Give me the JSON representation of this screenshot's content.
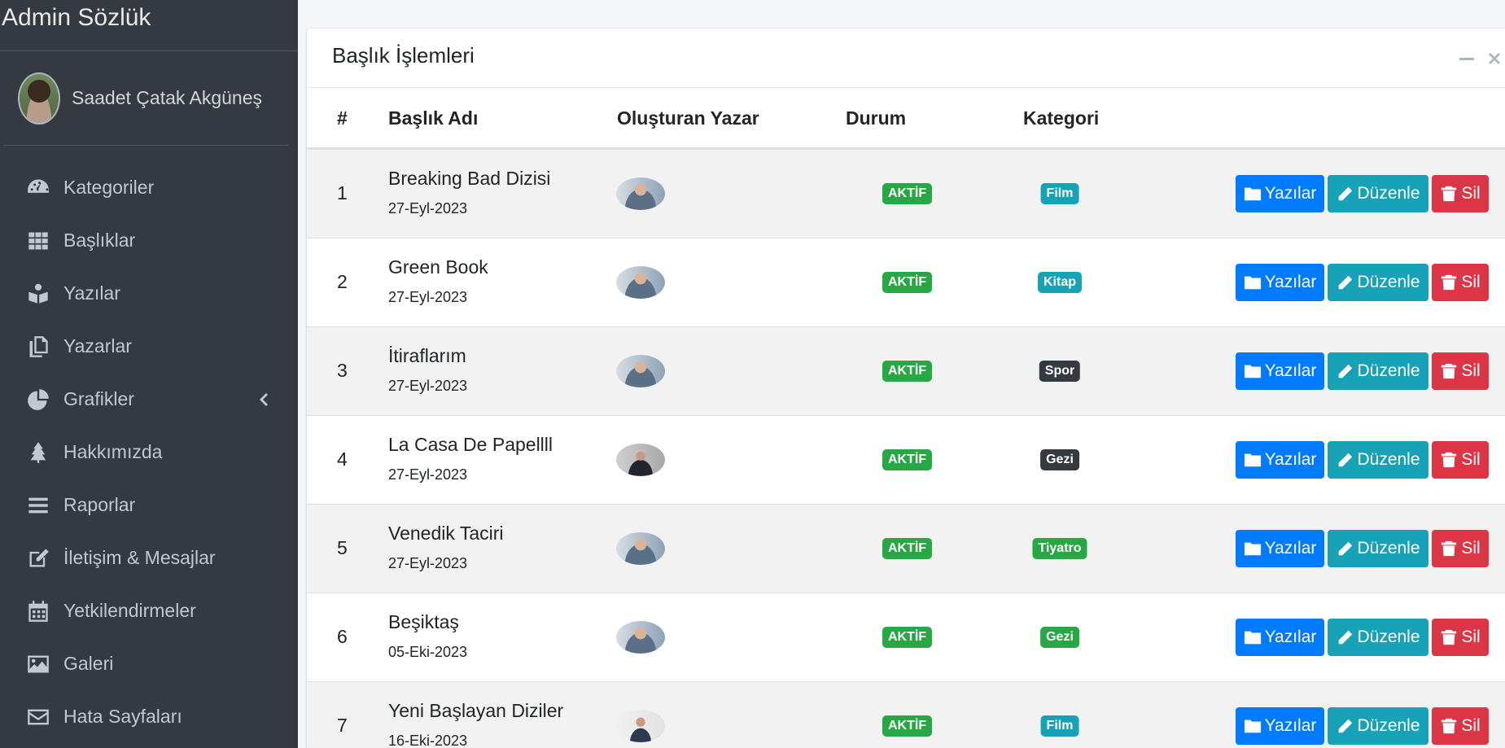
{
  "sidebar": {
    "brand": "Admin Sözlük",
    "user_name": "Saadet Çatak Akgüneş",
    "items": [
      {
        "label": "Kategoriler",
        "icon": "tachometer-icon"
      },
      {
        "label": "Başlıklar",
        "icon": "grid-icon"
      },
      {
        "label": "Yazılar",
        "icon": "book-reader-icon"
      },
      {
        "label": "Yazarlar",
        "icon": "copy-icon"
      },
      {
        "label": "Grafikler",
        "icon": "pie-chart-icon"
      },
      {
        "label": "Hakkımızda",
        "icon": "tree-icon"
      },
      {
        "label": "Raporlar",
        "icon": "bars-icon"
      },
      {
        "label": "İletişim & Mesajlar",
        "icon": "edit-icon"
      },
      {
        "label": "Yetkilendirmeler",
        "icon": "calendar-icon"
      },
      {
        "label": "Galeri",
        "icon": "image-icon"
      },
      {
        "label": "Hata Sayfaları",
        "icon": "envelope-icon"
      }
    ]
  },
  "card": {
    "title": "Başlık İşlemleri",
    "columns": [
      "#",
      "Başlık Adı",
      "Oluşturan Yazar",
      "Durum",
      "Kategori"
    ]
  },
  "rows": [
    {
      "num": "1",
      "title": "Breaking Bad Dizisi",
      "date": "27-Eyl-2023",
      "status": "AKTİF",
      "category": "Film"
    },
    {
      "num": "2",
      "title": "Green Book",
      "date": "27-Eyl-2023",
      "status": "AKTİF",
      "category": "Kitap"
    },
    {
      "num": "3",
      "title": "İtiraflarım",
      "date": "27-Eyl-2023",
      "status": "AKTİF",
      "category": "Spor"
    },
    {
      "num": "4",
      "title": "La Casa De Papellll",
      "date": "27-Eyl-2023",
      "status": "AKTİF",
      "category": "Gezi"
    },
    {
      "num": "5",
      "title": "Venedik Taciri",
      "date": "27-Eyl-2023",
      "status": "AKTİF",
      "category": "Tiyatro"
    },
    {
      "num": "6",
      "title": "Beşiktaş",
      "date": "05-Eki-2023",
      "status": "AKTİF",
      "category": "Gezi"
    },
    {
      "num": "7",
      "title": "Yeni Başlayan Diziler",
      "date": "16-Eki-2023",
      "status": "AKTİF",
      "category": "Film"
    }
  ],
  "actions": {
    "posts": "Yazılar",
    "edit": "Düzenle",
    "delete": "Sil"
  },
  "colors": {
    "sidebar_bg": "#343a40",
    "primary": "#007bff",
    "info": "#17a2b8",
    "danger": "#dc3545",
    "success": "#28a745",
    "dark": "#343a40",
    "badge_film": "#17a2b8",
    "badge_kitap": "#17a2b8",
    "badge_spor": "#343a40",
    "badge_gezi_dark": "#343a40",
    "badge_tiyatro": "#28a745",
    "badge_gezi_green": "#28a745"
  }
}
